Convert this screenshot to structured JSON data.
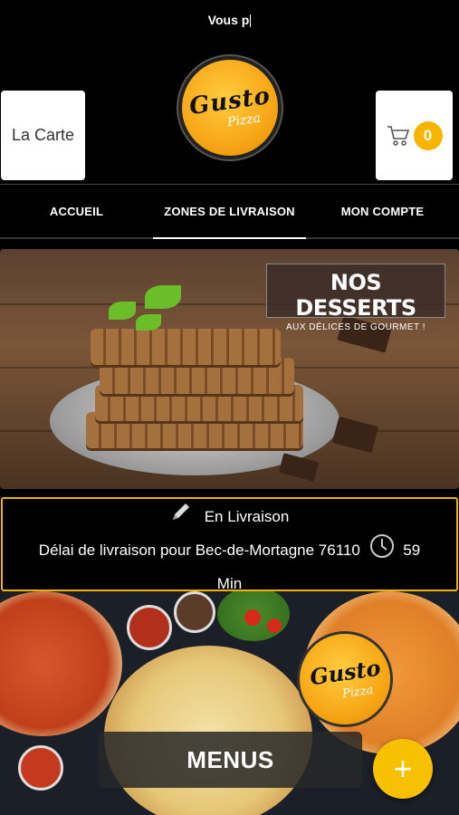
{
  "marquee": {
    "text": "Vous p"
  },
  "header": {
    "logo": {
      "script": "Gusto",
      "sub": "Pizza"
    },
    "carte_label": "La Carte",
    "cart_count": "0"
  },
  "nav": {
    "tabs": [
      {
        "label": "ACCUEIL"
      },
      {
        "label": "ZONES DE LIVRAISON"
      },
      {
        "label": "MON COMPTE"
      }
    ]
  },
  "hero": {
    "title": "NOS DESSERTS",
    "subtitle": "AUX DÉLICES DE GOURMET !"
  },
  "delivery": {
    "mode": "En Livraison",
    "delay_text": "Délai de livraison pour Bec-de-Mortagne 76110",
    "minutes": "59",
    "unit": "Min"
  },
  "promo": {
    "logo": {
      "script": "Gusto",
      "sub": "Pizza"
    }
  },
  "footer": {
    "menus_label": "MENUS",
    "fab_label": "+"
  },
  "colors": {
    "accent": "#f7b500",
    "background": "#000000"
  },
  "icons": {
    "cart": "cart-icon",
    "edit": "pencil-icon",
    "clock": "clock-icon",
    "add": "plus-icon"
  }
}
